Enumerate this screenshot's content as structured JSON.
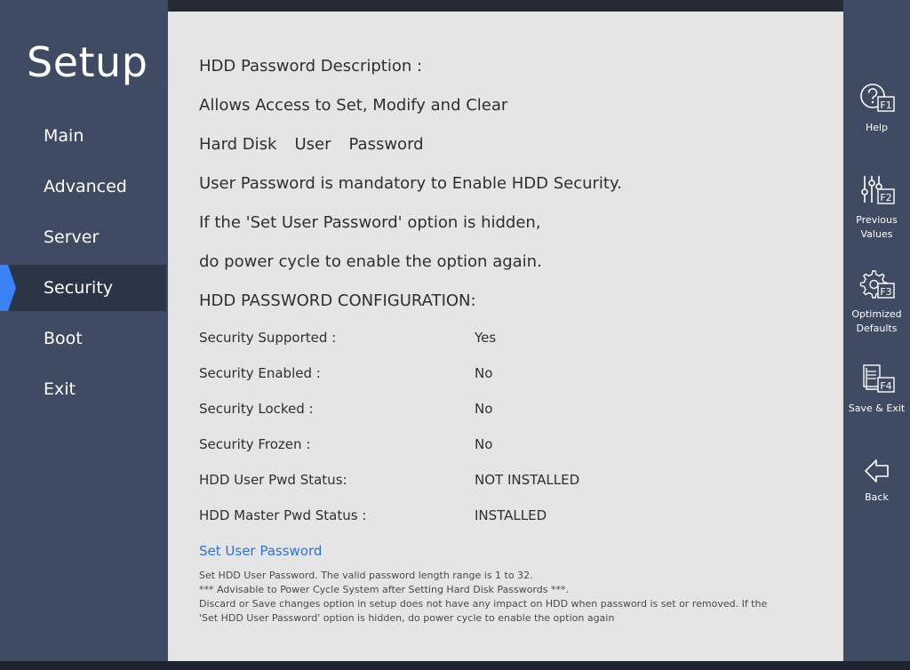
{
  "sidebar": {
    "title": "Setup",
    "items": [
      {
        "label": "Main",
        "active": false
      },
      {
        "label": "Advanced",
        "active": false
      },
      {
        "label": "Server",
        "active": false
      },
      {
        "label": "Security",
        "active": true
      },
      {
        "label": "Boot",
        "active": false
      },
      {
        "label": "Exit",
        "active": false
      }
    ]
  },
  "description": {
    "heading": "HDD Password Description :",
    "line1": "Allows Access to Set, Modify and Clear",
    "line2_words": [
      "Hard Disk",
      "User",
      "Password"
    ],
    "line3": "User Password is mandatory to Enable HDD Security.",
    "line4": "If the 'Set User Password' option is hidden,",
    "line5": "do power cycle to enable the option again.",
    "config_heading": "HDD PASSWORD CONFIGURATION:"
  },
  "status": [
    {
      "label": "Security Supported :",
      "value": "Yes"
    },
    {
      "label": "Security Enabled   :",
      "value": "No"
    },
    {
      "label": "Security Locked    :",
      "value": "No"
    },
    {
      "label": "Security Frozen    :",
      "value": "No"
    },
    {
      "label": "HDD User Pwd Status:",
      "value": "NOT INSTALLED"
    },
    {
      "label": "HDD Master Pwd Status :",
      "value": "INSTALLED"
    }
  ],
  "action": {
    "set_user_password": "Set User Password"
  },
  "help": {
    "line1": "Set HDD User Password. The valid password length range is 1 to 32.",
    "line2": "*** Advisable to Power Cycle System after Setting Hard Disk Passwords ***.",
    "line3": "Discard or Save changes option in setup does not have any impact on HDD when password is set or removed. If the 'Set HDD User Password' option is hidden, do power cycle to enable the option again"
  },
  "function_keys": [
    {
      "key": "F1",
      "label": "Help",
      "icon": "help-icon"
    },
    {
      "key": "F2",
      "label": "Previous Values",
      "icon": "sliders-icon"
    },
    {
      "key": "F3",
      "label": "Optimized Defaults",
      "icon": "gear-icon"
    },
    {
      "key": "F4",
      "label": "Save & Exit",
      "icon": "save-document-icon"
    },
    {
      "key": "",
      "label": "Back",
      "icon": "back-arrow-icon"
    }
  ],
  "colors": {
    "sidebar_bg": "#3f4b63",
    "active_item_bg": "#2c3546",
    "active_indicator": "#3b82f6",
    "content_bg": "#e5e5e5",
    "link": "#2d72d9"
  }
}
